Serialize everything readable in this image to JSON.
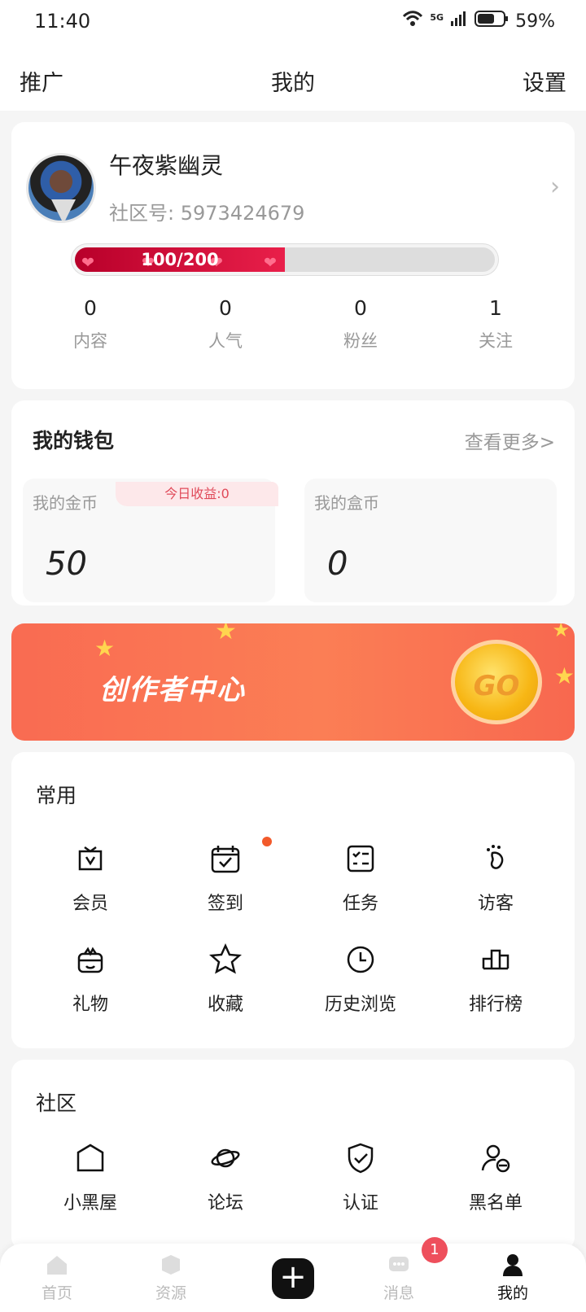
{
  "status": {
    "time": "11:40",
    "network": "5G",
    "battery": "59%"
  },
  "header": {
    "left": "推广",
    "title": "我的",
    "right": "设置"
  },
  "profile": {
    "name": "午夜紫幽灵",
    "community_id_label": "社区号:",
    "community_id": "5973424679",
    "progress_text": "100/200",
    "progress_fraction": 0.5
  },
  "stats": [
    {
      "value": "0",
      "label": "内容"
    },
    {
      "value": "0",
      "label": "人气"
    },
    {
      "value": "0",
      "label": "粉丝"
    },
    {
      "value": "1",
      "label": "关注"
    }
  ],
  "wallet": {
    "title": "我的钱包",
    "more": "查看更多>",
    "gold_label": "我的金币",
    "today_income": "今日收益:0",
    "gold_value": "50",
    "box_label": "我的盒币",
    "box_value": "0"
  },
  "banner": {
    "title": "创作者中心",
    "go": "GO"
  },
  "common": {
    "title": "常用",
    "items": [
      {
        "label": "会员",
        "icon": "vip-icon"
      },
      {
        "label": "签到",
        "icon": "calendar-check-icon"
      },
      {
        "label": "任务",
        "icon": "task-list-icon"
      },
      {
        "label": "访客",
        "icon": "footprint-icon"
      },
      {
        "label": "礼物",
        "icon": "gift-icon"
      },
      {
        "label": "收藏",
        "icon": "star-icon"
      },
      {
        "label": "历史浏览",
        "icon": "clock-icon"
      },
      {
        "label": "排行榜",
        "icon": "ranking-icon"
      }
    ]
  },
  "community": {
    "title": "社区",
    "items": [
      {
        "label": "小黑屋",
        "icon": "house-icon"
      },
      {
        "label": "论坛",
        "icon": "planet-icon"
      },
      {
        "label": "认证",
        "icon": "shield-check-icon"
      },
      {
        "label": "黑名单",
        "icon": "block-user-icon"
      }
    ]
  },
  "tabs": {
    "home": "首页",
    "resources": "资源",
    "messages": "消息",
    "mine": "我的",
    "message_badge": "1"
  },
  "colors": {
    "accent": "#e91f4a",
    "banner": "#fb7e55",
    "badge": "#ee4f5c"
  }
}
